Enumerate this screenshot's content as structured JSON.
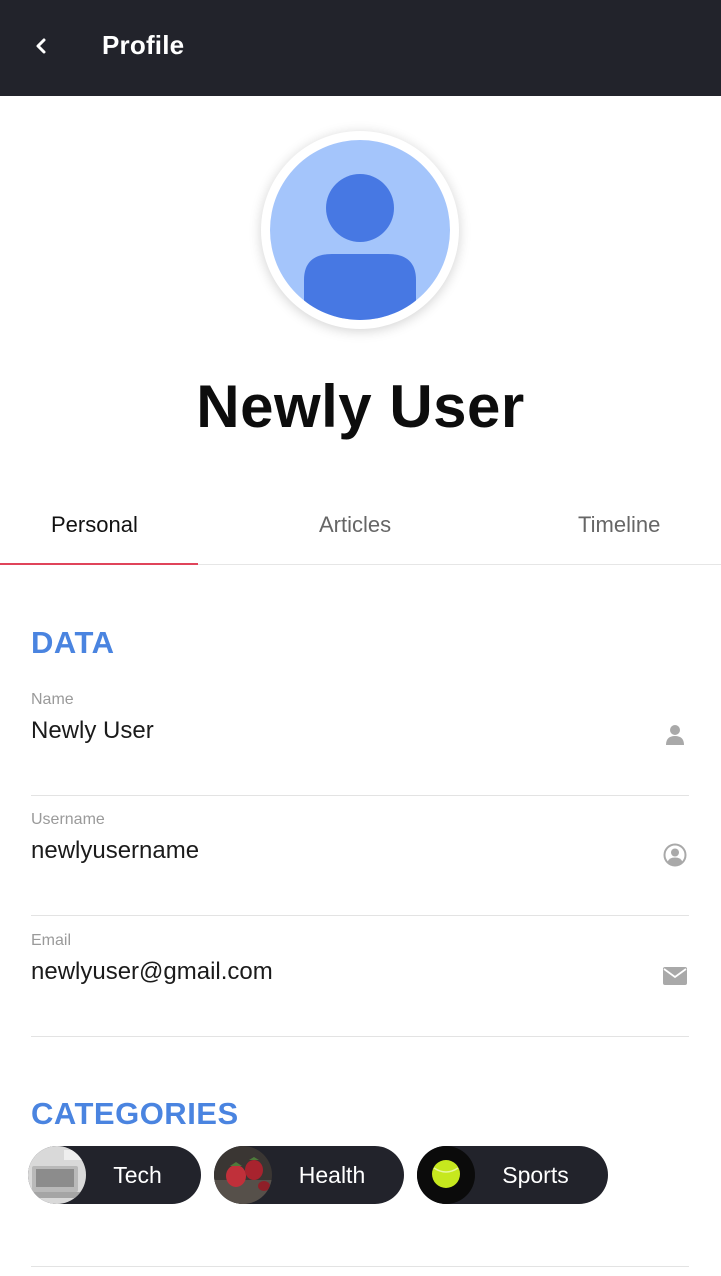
{
  "header": {
    "title": "Profile",
    "back_icon": "chevron-left-icon"
  },
  "profile": {
    "name": "Newly User",
    "avatar_icon": "user-avatar-icon"
  },
  "tabs": [
    {
      "label": "Personal",
      "active": true
    },
    {
      "label": "Articles",
      "active": false
    },
    {
      "label": "Timeline",
      "active": false
    }
  ],
  "data_section": {
    "title": "DATA",
    "fields": [
      {
        "label": "Name",
        "value": "Newly User",
        "icon": "user-icon"
      },
      {
        "label": "Username",
        "value": "newlyusername",
        "icon": "user-circle-icon"
      },
      {
        "label": "Email",
        "value": "newlyuser@gmail.com",
        "icon": "envelope-icon"
      }
    ]
  },
  "categories_section": {
    "title": "CATEGORIES",
    "items": [
      {
        "label": "Tech",
        "thumb": "laptop-image"
      },
      {
        "label": "Health",
        "thumb": "strawberries-image"
      },
      {
        "label": "Sports",
        "thumb": "tennis-ball-image"
      }
    ]
  },
  "colors": {
    "header_bg": "#22232b",
    "accent_blue": "#4a84e0",
    "tab_indicator": "#e0445a",
    "avatar_bg": "#a4c5fb",
    "avatar_fg": "#4778e3"
  }
}
